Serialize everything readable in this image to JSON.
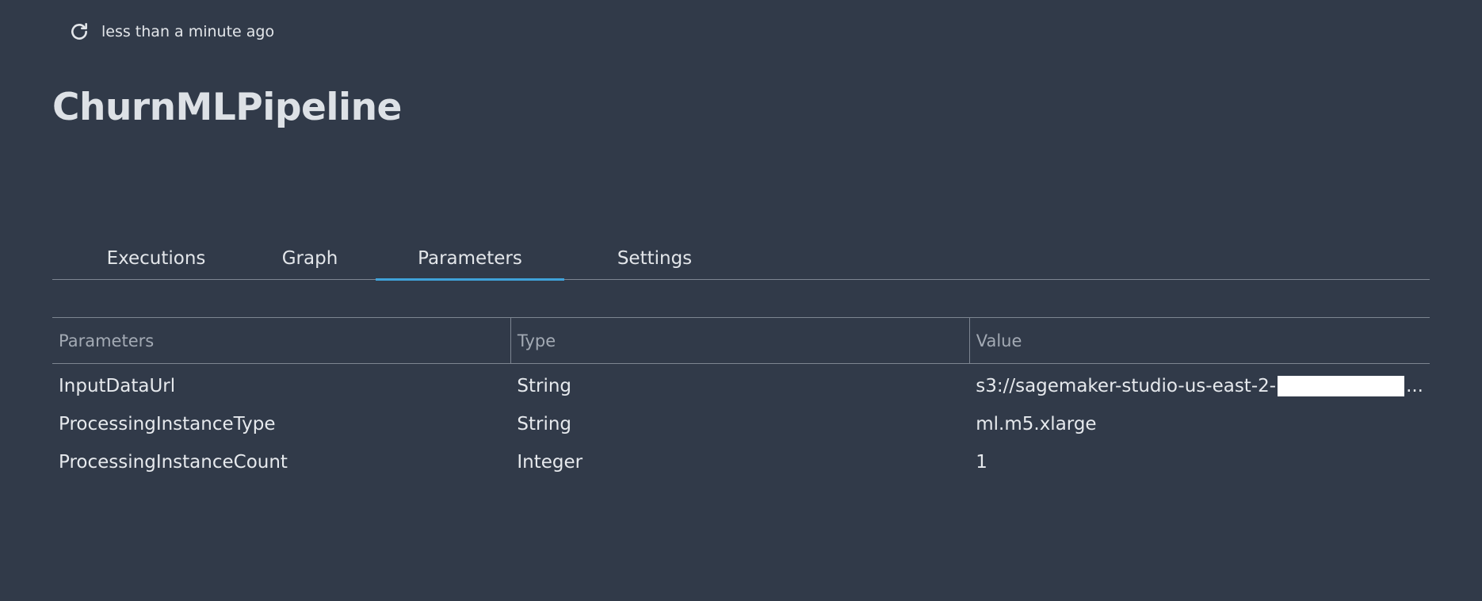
{
  "header": {
    "refresh_icon": "refresh-icon",
    "refresh_text": "less than a minute ago",
    "title": "ChurnMLPipeline"
  },
  "tabs": [
    {
      "label": "Executions",
      "active": false
    },
    {
      "label": "Graph",
      "active": false
    },
    {
      "label": "Parameters",
      "active": true
    },
    {
      "label": "Settings",
      "active": false
    }
  ],
  "table": {
    "columns": [
      "Parameters",
      "Type",
      "Value"
    ],
    "rows": [
      {
        "name": "InputDataUrl",
        "type": "String",
        "value": "s3://sagemaker-studio-us-east-2-",
        "redacted_suffix": true,
        "ellipsis": "..."
      },
      {
        "name": "ProcessingInstanceType",
        "type": "String",
        "value": "ml.m5.xlarge"
      },
      {
        "name": "ProcessingInstanceCount",
        "type": "Integer",
        "value": "1"
      }
    ]
  },
  "colors": {
    "background": "#313a49",
    "active_tab_underline": "#3fa2d9",
    "divider": "#7d8591"
  }
}
